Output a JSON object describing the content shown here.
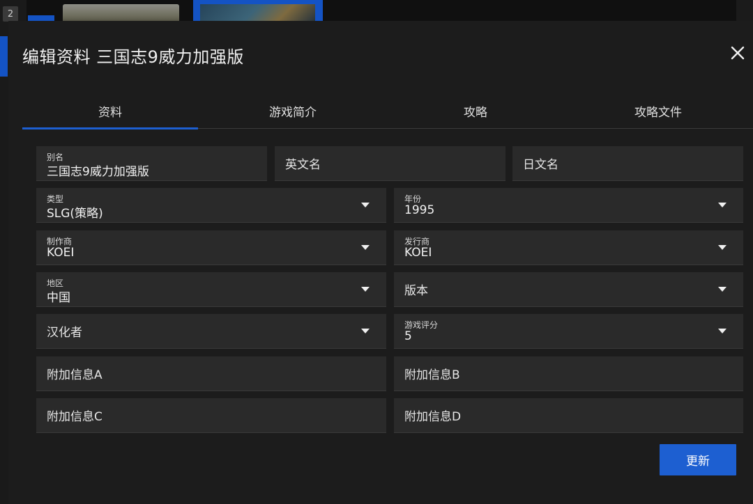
{
  "background": {
    "badge": "2"
  },
  "dialog": {
    "title": "编辑资料 三国志9威力加强版",
    "tabs": [
      {
        "label": "资料",
        "active": true
      },
      {
        "label": "游戏简介",
        "active": false
      },
      {
        "label": "攻略",
        "active": false
      },
      {
        "label": "攻略文件",
        "active": false
      }
    ],
    "fields": {
      "alias": {
        "label": "别名",
        "value": "三国志9威力加强版"
      },
      "english_name": {
        "label": "英文名",
        "value": ""
      },
      "japanese_name": {
        "label": "日文名",
        "value": ""
      },
      "genre": {
        "label": "类型",
        "value": "SLG(策略)"
      },
      "year": {
        "label": "年份",
        "value": "1995"
      },
      "developer": {
        "label": "制作商",
        "value": "KOEI"
      },
      "publisher": {
        "label": "发行商",
        "value": "KOEI"
      },
      "region": {
        "label": "地区",
        "value": "中国"
      },
      "version": {
        "label": "版本",
        "value": ""
      },
      "translator": {
        "label": "汉化者",
        "value": ""
      },
      "rating": {
        "label": "游戏评分",
        "value": "5"
      },
      "extra_a": {
        "label": "附加信息A",
        "value": ""
      },
      "extra_b": {
        "label": "附加信息B",
        "value": ""
      },
      "extra_c": {
        "label": "附加信息C",
        "value": ""
      },
      "extra_d": {
        "label": "附加信息D",
        "value": ""
      }
    },
    "update_label": "更新"
  },
  "colors": {
    "accent": "#1d5fd1",
    "dialog_bg": "#1c1c1c",
    "field_bg": "#2a2a2a"
  }
}
